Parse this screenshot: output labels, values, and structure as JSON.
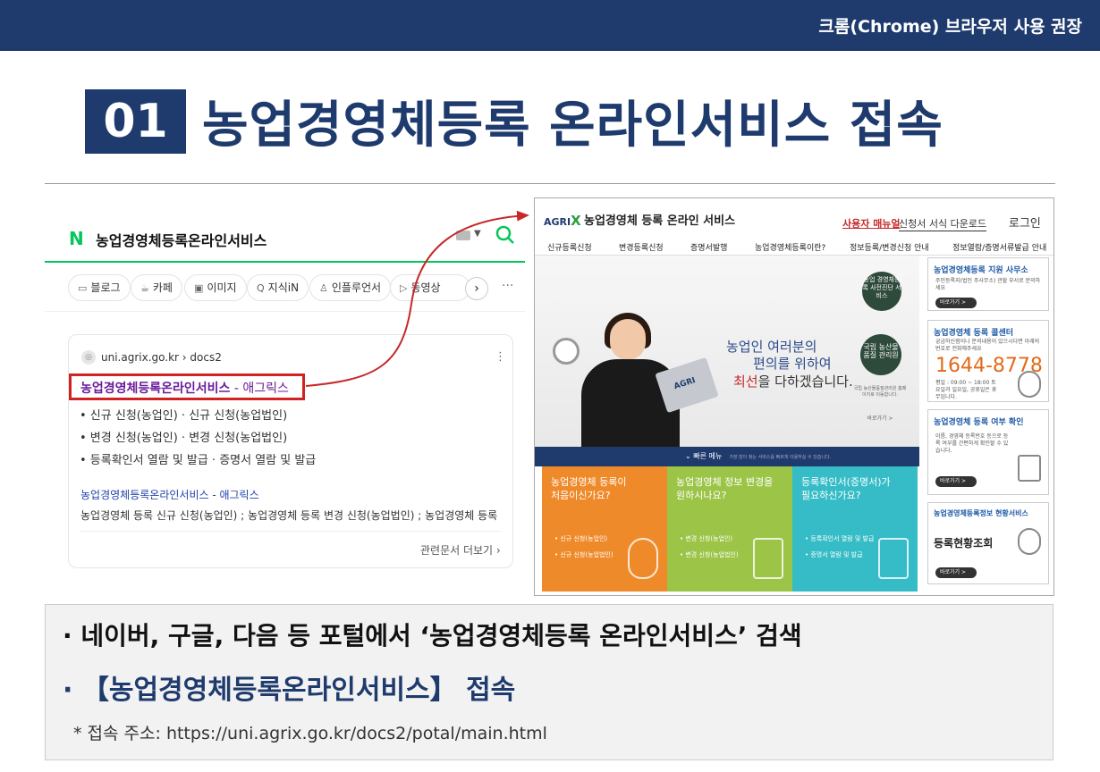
{
  "header": {
    "top_title": "크롬(Chrome) 브라우저 사용 권장"
  },
  "slide": {
    "number": "01",
    "title": "농업경영체등록 온라인서비스 접속"
  },
  "naver": {
    "logo": "N",
    "query": "농업경영체등록온라인서비스",
    "chips": [
      "블로그",
      "카페",
      "이미지",
      "지식iN",
      "인플루언서",
      "동영상"
    ],
    "result": {
      "url": "uni.agrix.go.kr › docs2",
      "title_main": "농업경영체등록온라인서비스",
      "title_site": " - 애그릭스",
      "bullets": [
        "• 신규 신청(농업인) · 신규 신청(농업법인)",
        "• 변경 신청(농업인) · 변경 신청(농업법인)",
        "• 등록확인서 열람 및 발급 · 증명서 열람 및 발급"
      ],
      "sub_title": "농업경영체등록온라인서비스 - 애그릭스",
      "sub_desc": "농업경영체 등록 신규 신청(농업인) ; 농업경영체 등록 변경 신청(농업법인) ; 농업경영체 등록 신...",
      "related": "관련문서 더보기 ›"
    }
  },
  "agrix": {
    "logo": "AGRI",
    "logo_x": "X",
    "name": "농업경영체 등록 온라인 서비스",
    "manual": "사용자 매뉴얼",
    "forms": "신청서 서식 다운로드",
    "login": "로그인",
    "menu": [
      "신규등록신청",
      "변경등록신청",
      "증명서발행",
      "농업경영체등록이란?",
      "정보등록/변경신청 안내",
      "정보열람/증명서류발급 안내"
    ],
    "slogan_1": "농업인 여러분의",
    "slogan_2": "편의를 위하여",
    "slogan_3a": "최선",
    "slogan_3b": "을 다하겠습니다.",
    "circle_1": "농업 경영체등록 사전진단 서비스",
    "circle_2": "국립 농산물품질 관리원",
    "circle_note": "국립 농산물품질관리원 홈페이지로 이동합니다.",
    "circle_more": "바로가기 >",
    "quick_title": "빠른 메뉴",
    "quick_desc": "가장 많이 찾는 서비스를 빠르게 이용하실 수 있습니다.",
    "panels": [
      {
        "h1": "농업경영체 등록이",
        "h2": "처음이신가요?",
        "l1": "• 신규 신청(농업인)",
        "l2": "• 신규 신청(농업법인)",
        "color": "#ef8a2b"
      },
      {
        "h1": "농업경영체 정보 변경을",
        "h2": "원하시나요?",
        "l1": "• 변경 신청(농업인)",
        "l2": "• 변경 신청(농업법인)",
        "color": "#9cc447"
      },
      {
        "h1": "등록확인서(증명서)가",
        "h2": "필요하신가요?",
        "l1": "• 등록확인서 열람 및 발급",
        "l2": "• 증명서 열람 및 발급",
        "color": "#36bcc6"
      }
    ],
    "sidebar": {
      "office_title": "농업경영체등록 지원 사무소",
      "office_desc": "주민등록지(법인 주사무소) 관할 부서로 문의하세요",
      "call_title": "농업경영체 등록 콜센터",
      "call_desc": "궁금하신점이나 문의내용이 있으시다면 아래의 번호로 전화해주세요",
      "phone": "1644-8778",
      "hours": "평일 : 09:00 ~ 18:00 토요일과 일요일, 공휴일은 휴무입니다.",
      "check_title": "농업경영체 등록 여부 확인",
      "check_desc": "이름, 경영체 등록번호 등으로 등록 여부를 간편하게 확인할 수 있습니다.",
      "status_title": "농업경영체등록정보 현황서비스",
      "status_btn": "등록현황조회",
      "go": "바로가기 >"
    }
  },
  "info": {
    "line1": "· 네이버, 구글, 다음 등 포털에서 ‘농업경영체등록 온라인서비스’ 검색",
    "line2": "· 【농업경영체등록온라인서비스】 접속",
    "line3": "* 접속 주소: https://uni.agrix.go.kr/docs2/potal/main.html"
  }
}
